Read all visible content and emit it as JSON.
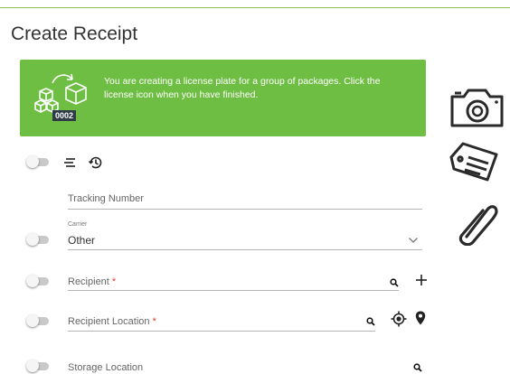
{
  "page": {
    "title": "Create Receipt"
  },
  "banner": {
    "message": "You are creating a license plate for a group of packages. Click the license icon when you have finished.",
    "plate_number": "0002",
    "color": "#6fbe44"
  },
  "toolbar_row": {
    "icons": [
      "list-icon",
      "history-icon"
    ]
  },
  "fields": {
    "tracking_number": {
      "label": "Tracking Number",
      "value": ""
    },
    "carrier": {
      "label": "Carrier",
      "value": "Other"
    },
    "recipient": {
      "label": "Recipient",
      "required_mark": "*"
    },
    "recipient_location": {
      "label": "Recipient Location",
      "required_mark": "*"
    },
    "storage_location": {
      "label": "Storage Location"
    }
  },
  "side_actions": {
    "icons": [
      "camera-icon",
      "label-tag-icon",
      "paperclip-icon"
    ]
  },
  "colors": {
    "accent": "#8bc34a",
    "banner": "#6fbe44",
    "required": "#e53935"
  }
}
